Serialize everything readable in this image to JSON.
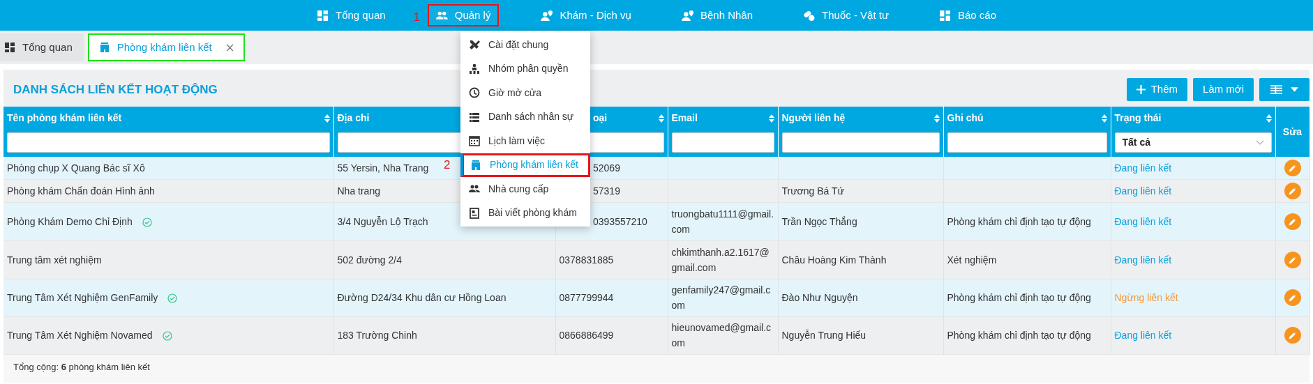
{
  "navbar": {
    "items": [
      {
        "label": "Tổng quan",
        "selected": false,
        "annotated": false
      },
      {
        "label": "Quản lý",
        "selected": true,
        "annotated": true,
        "marker": "1"
      },
      {
        "label": "Khám - Dịch vụ",
        "selected": false,
        "annotated": false
      },
      {
        "label": "Bệnh Nhân",
        "selected": false,
        "annotated": false
      },
      {
        "label": "Thuốc - Vật tư",
        "selected": false,
        "annotated": false
      },
      {
        "label": "Báo cáo",
        "selected": false,
        "annotated": false
      }
    ]
  },
  "dropdown": {
    "items": [
      {
        "label": "Cài đặt chung",
        "selected": false,
        "annotated": false
      },
      {
        "label": "Nhóm phân quyền",
        "selected": false,
        "annotated": false
      },
      {
        "label": "Giờ mở cửa",
        "selected": false,
        "annotated": false
      },
      {
        "label": "Danh sách nhân sự",
        "selected": false,
        "annotated": false
      },
      {
        "label": "Lịch làm việc",
        "selected": false,
        "annotated": false
      },
      {
        "label": "Phòng khám liên kết",
        "selected": true,
        "annotated": true,
        "marker": "2"
      },
      {
        "label": "Nhà cung cấp",
        "selected": false,
        "annotated": false
      },
      {
        "label": "Bài viết phòng khám",
        "selected": false,
        "annotated": false
      }
    ]
  },
  "tabs": [
    {
      "label": "Tổng quan",
      "selected": false,
      "closable": false,
      "annotated": false
    },
    {
      "label": "Phòng khám liên kết",
      "selected": true,
      "closable": true,
      "annotated": true
    }
  ],
  "page": {
    "title": "DANH SÁCH LIÊN KẾT HOẠT ĐỘNG",
    "buttons": [
      {
        "kind": "add",
        "label": "Thêm"
      },
      {
        "kind": "refresh",
        "label": "Làm mới"
      },
      {
        "kind": "columns"
      }
    ]
  },
  "table": {
    "columns": [
      {
        "label": "Tên phòng khám liên kết",
        "sortable": true,
        "kind": "text-filter"
      },
      {
        "label": "Địa chỉ",
        "sortable": false,
        "kind": "text-filter"
      },
      {
        "label": "oại",
        "sortable": true,
        "kind": "text-filter"
      },
      {
        "label": "Email",
        "sortable": true,
        "kind": "text-filter"
      },
      {
        "label": "Người liên hệ",
        "sortable": true,
        "kind": "text-filter"
      },
      {
        "label": "Ghi chú",
        "sortable": true,
        "kind": "text-filter"
      },
      {
        "label": "Trạng thái",
        "sortable": true,
        "kind": "select-filter",
        "filter_value": "Tất cả"
      },
      {
        "label": "Sửa",
        "sortable": false,
        "kind": "plain"
      }
    ],
    "rows": [
      {
        "name": "Phòng chụp X Quang Bác sĩ Xô",
        "verified": false,
        "address": "55 Yersin, Nha Trang",
        "phone": "52069",
        "status": "Đang liên kết",
        "linked": true
      },
      {
        "name": "Phòng khám Chẩn đoán Hình ảnh",
        "verified": false,
        "address": "Nha trang",
        "phone": "57319",
        "contact": "Trương Bá Tứ",
        "status": "Đang liên kết",
        "linked": true
      },
      {
        "name": "Phòng Khám Demo Chỉ Định",
        "verified": true,
        "address": "3/4 Nguyễn Lộ Trạch",
        "phone": "0393557210",
        "email": "truongbatu1111@gmail.com",
        "contact": "Trần Ngọc Thắng",
        "note": "Phòng khám chỉ định tạo tự động",
        "status": "Đang liên kết",
        "linked": true
      },
      {
        "name": "Trung tâm xét nghiệm",
        "verified": false,
        "address": "502 đường 2/4",
        "phone": "0378831885",
        "email": "chkimthanh.a2.1617@gmail.com",
        "contact": "Châu Hoàng Kim Thành",
        "note": "Xét nghiệm",
        "status": "Đang liên kết",
        "linked": true
      },
      {
        "name": "Trung Tâm Xét Nghiệm GenFamily",
        "verified": true,
        "address": "Đường D24/34 Khu dân cư Hồng Loan",
        "phone": "0877799944",
        "email": "genfamily247@gmail.com",
        "contact": "Đào Như Nguyện",
        "note": "Phòng khám chỉ định tạo tự động",
        "status": "Ngừng liên kết",
        "linked": false
      },
      {
        "name": "Trung Tâm Xét Nghiệm Novamed",
        "verified": true,
        "address": "183 Trường Chinh",
        "phone": "0866886499",
        "email": "hieunovamed@gmail.com",
        "contact": "Nguyễn Trung Hiếu",
        "note": "Phòng khám chỉ định tạo tự động",
        "status": "Đang liên kết",
        "linked": true
      }
    ],
    "footer": "Tổng cộng: **6** phòng khám liên kết"
  }
}
